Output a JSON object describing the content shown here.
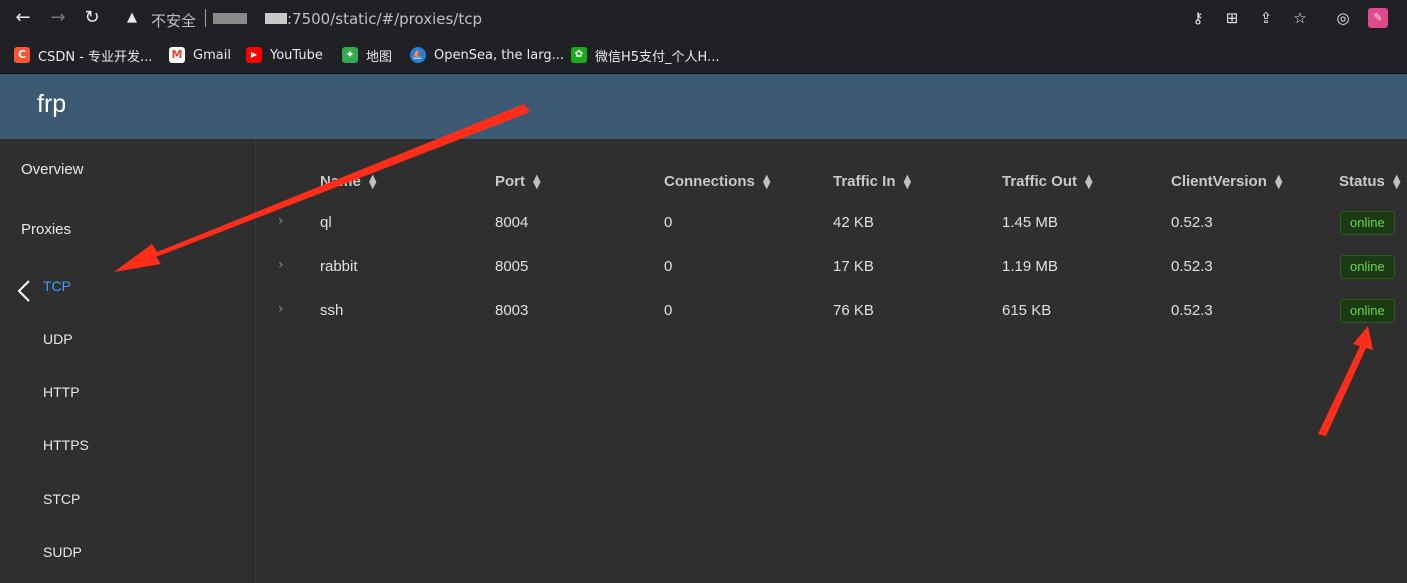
{
  "browser": {
    "insecure_label": "不安全",
    "url_visible": ":7500/static/#/proxies/tcp",
    "bookmarks": [
      {
        "label": "CSDN - 专业开发...",
        "icon": "csdn-icon",
        "color": "#fc5531",
        "glyph": "C"
      },
      {
        "label": "Gmail",
        "icon": "gmail-icon",
        "color": "#ea4335",
        "glyph": "M"
      },
      {
        "label": "YouTube",
        "icon": "youtube-icon",
        "color": "#ff0000",
        "glyph": "▶"
      },
      {
        "label": "地图",
        "icon": "maps-icon",
        "color": "#34a853",
        "glyph": "✦"
      },
      {
        "label": "OpenSea, the larg...",
        "icon": "opensea-icon",
        "color": "#2081e2",
        "glyph": "⛵"
      },
      {
        "label": "微信H5支付_个人H...",
        "icon": "wechat-pay-icon",
        "color": "#1aad19",
        "glyph": "✿"
      }
    ]
  },
  "app": {
    "title": "frp"
  },
  "sidebar": {
    "items": [
      {
        "label": "Overview"
      },
      {
        "label": "Proxies"
      }
    ],
    "subitems": [
      {
        "label": "TCP",
        "active": true
      },
      {
        "label": "UDP"
      },
      {
        "label": "HTTP"
      },
      {
        "label": "HTTPS"
      },
      {
        "label": "STCP"
      },
      {
        "label": "SUDP"
      }
    ]
  },
  "table": {
    "columns": [
      "Name",
      "Port",
      "Connections",
      "Traffic In",
      "Traffic Out",
      "ClientVersion",
      "Status"
    ],
    "rows": [
      {
        "name": "ql",
        "port": "8004",
        "connections": "0",
        "traffic_in": "42 KB",
        "traffic_out": "1.45 MB",
        "client_version": "0.52.3",
        "status": "online"
      },
      {
        "name": "rabbit",
        "port": "8005",
        "connections": "0",
        "traffic_in": "17 KB",
        "traffic_out": "1.19 MB",
        "client_version": "0.52.3",
        "status": "online"
      },
      {
        "name": "ssh",
        "port": "8003",
        "connections": "0",
        "traffic_in": "76 KB",
        "traffic_out": "615 KB",
        "client_version": "0.52.3",
        "status": "online"
      }
    ]
  },
  "colors": {
    "header_bg": "#3d5a75",
    "active_link": "#409eff",
    "status_online": "#6fd34a",
    "annotation_arrow": "#ff2d1a"
  }
}
